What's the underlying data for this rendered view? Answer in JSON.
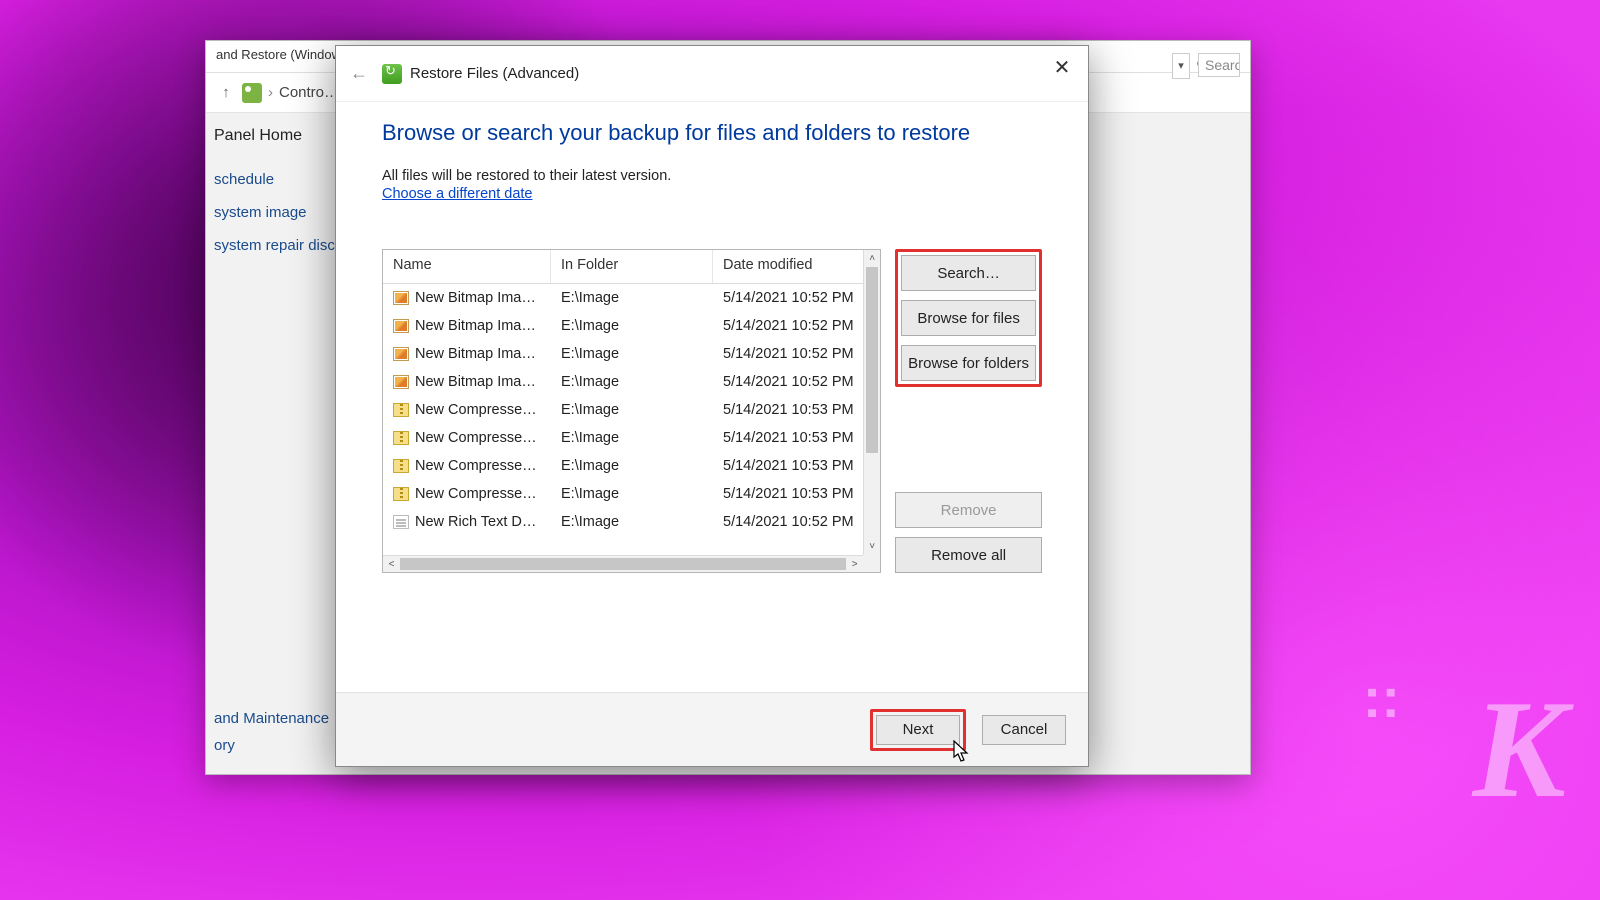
{
  "outer": {
    "title": "and Restore (Window…",
    "breadcrumb": "Contro…",
    "searchPlaceholder": "Search",
    "panelHome": "Panel Home",
    "links": [
      "schedule",
      "system image",
      "system repair disc"
    ],
    "bottomLinks": [
      "and Maintenance",
      "ory"
    ]
  },
  "dialog": {
    "title": "Restore Files (Advanced)",
    "heading": "Browse or search your backup for files and folders to restore",
    "subtext": "All files will be restored to their latest version.",
    "dateLink": "Choose a different date",
    "columns": {
      "name": "Name",
      "folder": "In Folder",
      "date": "Date modified"
    },
    "rows": [
      {
        "icon": "bmp",
        "name": "New Bitmap Ima…",
        "folder": "E:\\Image",
        "date": "5/14/2021 10:52 PM"
      },
      {
        "icon": "bmp",
        "name": "New Bitmap Ima…",
        "folder": "E:\\Image",
        "date": "5/14/2021 10:52 PM"
      },
      {
        "icon": "bmp",
        "name": "New Bitmap Ima…",
        "folder": "E:\\Image",
        "date": "5/14/2021 10:52 PM"
      },
      {
        "icon": "bmp",
        "name": "New Bitmap Ima…",
        "folder": "E:\\Image",
        "date": "5/14/2021 10:52 PM"
      },
      {
        "icon": "zip",
        "name": "New Compresse…",
        "folder": "E:\\Image",
        "date": "5/14/2021 10:53 PM"
      },
      {
        "icon": "zip",
        "name": "New Compresse…",
        "folder": "E:\\Image",
        "date": "5/14/2021 10:53 PM"
      },
      {
        "icon": "zip",
        "name": "New Compresse…",
        "folder": "E:\\Image",
        "date": "5/14/2021 10:53 PM"
      },
      {
        "icon": "zip",
        "name": "New Compresse…",
        "folder": "E:\\Image",
        "date": "5/14/2021 10:53 PM"
      },
      {
        "icon": "rtf",
        "name": "New Rich Text D…",
        "folder": "E:\\Image",
        "date": "5/14/2021 10:52 PM"
      }
    ],
    "buttons": {
      "search": "Search…",
      "browseFiles": "Browse for files",
      "browseFolders": "Browse for folders",
      "remove": "Remove",
      "removeAll": "Remove all",
      "next": "Next",
      "cancel": "Cancel"
    }
  }
}
